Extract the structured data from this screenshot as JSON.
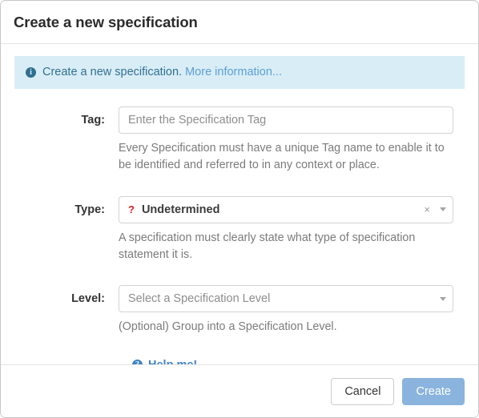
{
  "dialog": {
    "title": "Create a new specification"
  },
  "alert": {
    "icon": "info-circle-icon",
    "text": "Create a new specification.",
    "link_label": "More information...",
    "background_color": "#d9edf7",
    "text_color": "#31708f",
    "link_color": "#5a9fd4"
  },
  "form": {
    "tag": {
      "label": "Tag:",
      "value": "",
      "placeholder": "Enter the Specification Tag",
      "help": "Every Specification must have a unique Tag name to enable it to be identified and referred to in any context or place."
    },
    "type": {
      "label": "Type:",
      "icon": "question-mark-icon",
      "icon_color": "#e01b1b",
      "value": "Undetermined",
      "clear_label": "×",
      "caret": "caret-down-icon",
      "help": "A specification must clearly state what type of specification statement it is."
    },
    "level": {
      "label": "Level:",
      "value": "",
      "placeholder": "Select a Specification Level",
      "caret": "caret-down-icon",
      "help": "(Optional) Group into a Specification Level."
    }
  },
  "help_link": {
    "icon": "question-circle-icon",
    "label": "Help me!",
    "color": "#3f82c4"
  },
  "footer": {
    "cancel_label": "Cancel",
    "create_label": "Create",
    "create_color": "#8ab4dd"
  }
}
